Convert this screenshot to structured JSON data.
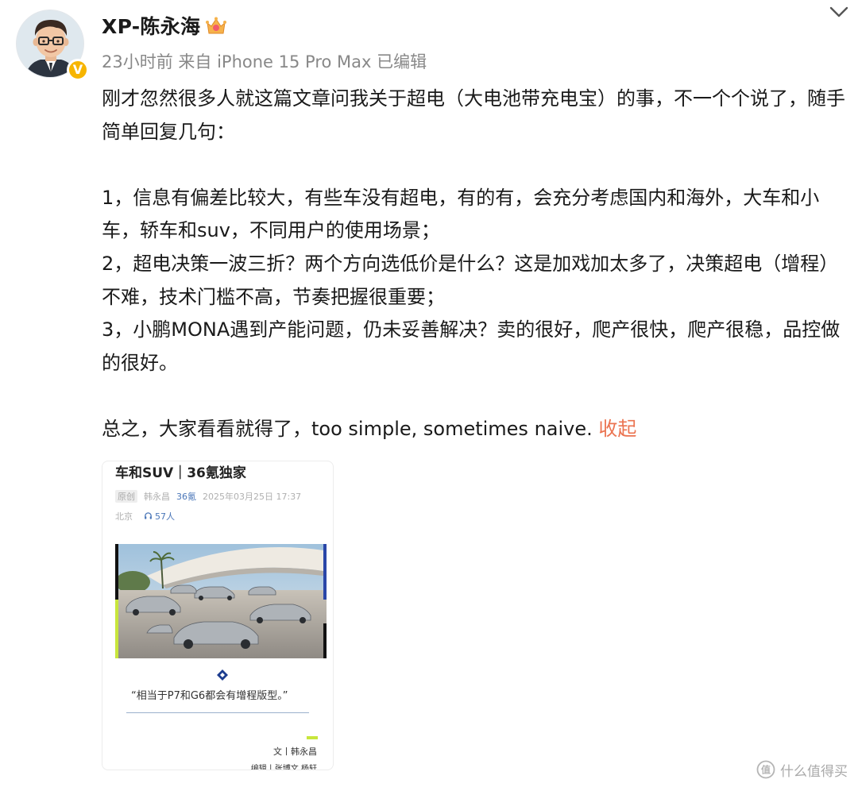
{
  "post_header": {
    "username": "XP-陈永海",
    "meta": "23小时前 来自 iPhone 15 Pro Max 已编辑",
    "verified_mark": "V"
  },
  "post_body": {
    "para1": "刚才忽然很多人就这篇文章问我关于超电（大电池带充电宝）的事，不一个个说了，随手简单回复几句：",
    "item1": "1，信息有偏差比较大，有些车没有超电，有的有，会充分考虑国内和海外，大车和小车，轿车和suv，不同用户的使用场景；",
    "item2": "2，超电决策一波三折？两个方向选低价是什么？这是加戏加太多了，决策超电（增程）不难，技术门槛不高，节奏把握很重要；",
    "item3": "3，小鹏MONA遇到产能问题，仍未妥善解决？卖的很好，爬产很快，爬产很稳，品控做的很好。",
    "summary": "总之，大家看看就得了，too simple, sometimes naive. ",
    "fold_link": "收起"
  },
  "article_card": {
    "title": "车和SUV｜36氪独家",
    "tag": "原创",
    "author_name": "韩永昌",
    "source": "36氪",
    "datetime": "2025年03月25日 17:37",
    "location": "北京",
    "listeners": "57人",
    "quote": "“相当于P7和G6都会有增程版型。”",
    "author_line": "文丨韩永昌",
    "editor_line": "编辑丨张博文 杨轩"
  },
  "watermark": {
    "text": "什么值得买"
  },
  "colors": {
    "link": "#eb7350",
    "meta": "#888888",
    "badge": "#f7b500",
    "accent_green": "#c8e63c",
    "source_blue": "#4a76b8"
  },
  "icons": [
    "avatar",
    "verified-icon",
    "vip-crown-icon",
    "chevron-down-icon",
    "headphone-icon",
    "diamond-icon",
    "smzdm-logo-icon"
  ]
}
